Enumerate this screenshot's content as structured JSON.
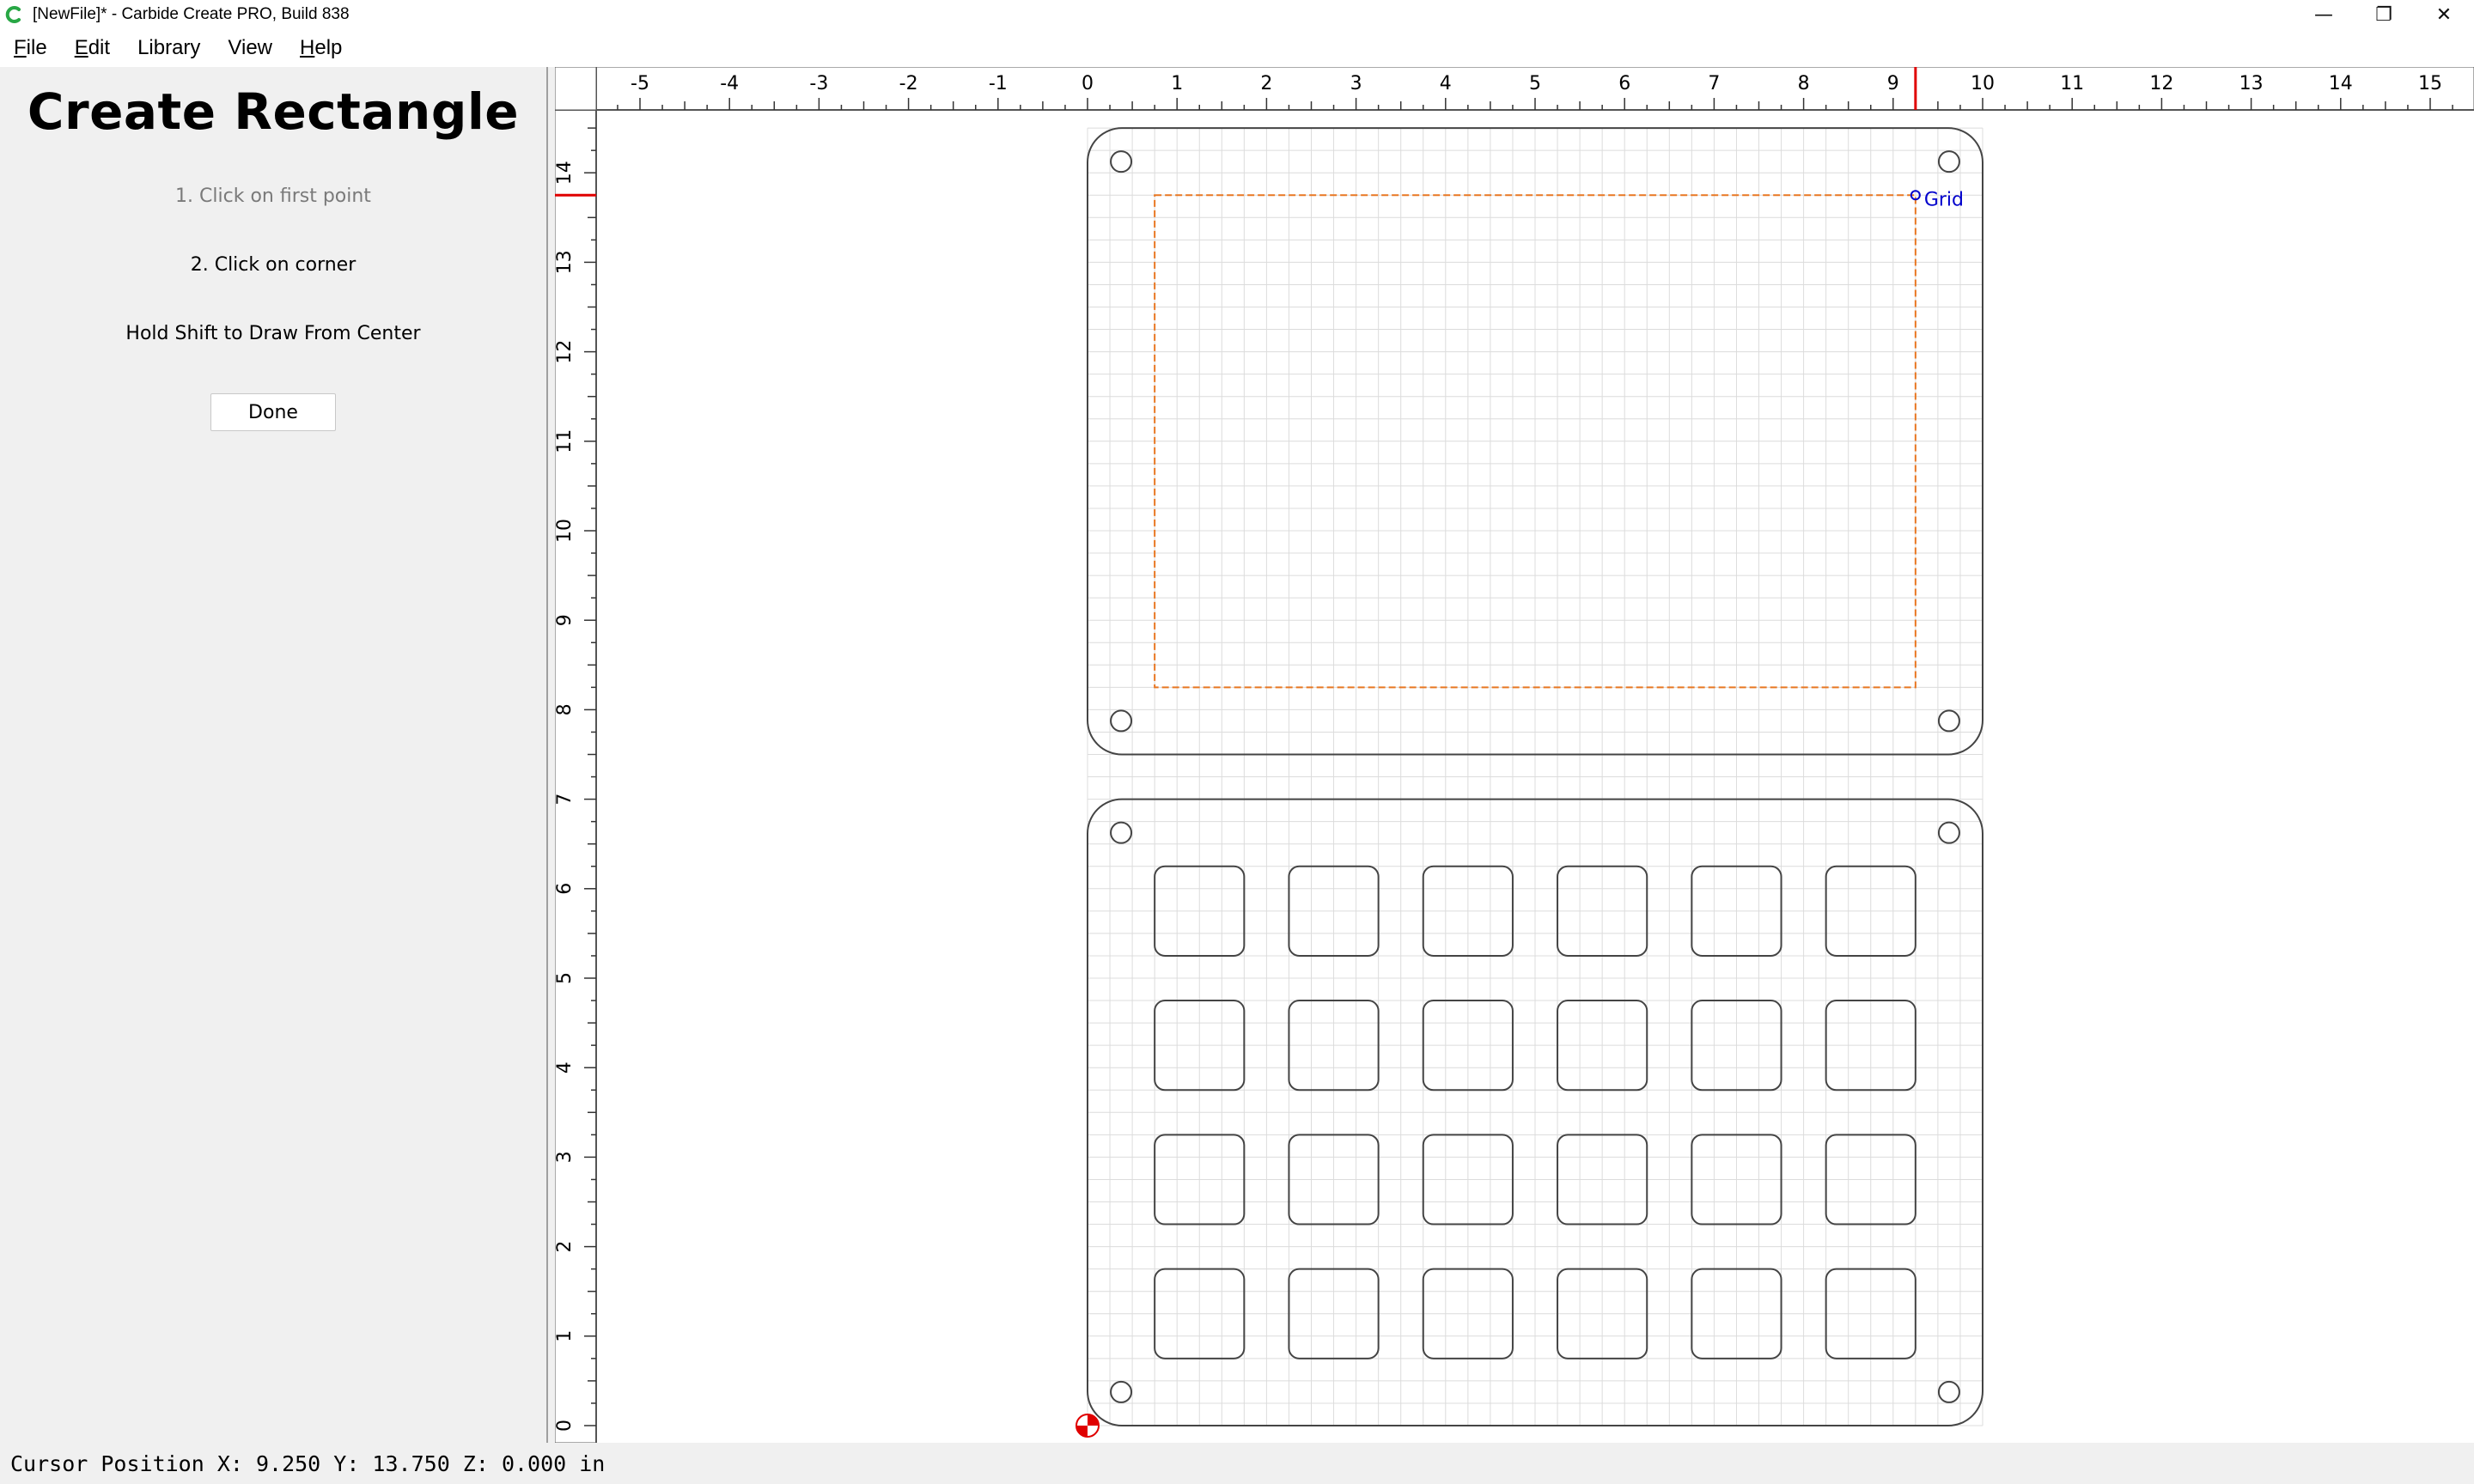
{
  "window": {
    "title": "[NewFile]* - Carbide Create PRO, Build 838",
    "minimize_glyph": "—",
    "restore_glyph": "❐",
    "close_glyph": "✕",
    "app_icon": "carbide-c-icon",
    "accent_color": "#28a745"
  },
  "menu": {
    "items": [
      {
        "mnemonic": "F",
        "rest": "ile"
      },
      {
        "mnemonic": "E",
        "rest": "dit"
      },
      {
        "mnemonic": "",
        "rest": "Library"
      },
      {
        "mnemonic": "",
        "rest": "View"
      },
      {
        "mnemonic": "H",
        "rest": "elp"
      }
    ]
  },
  "panel": {
    "title": "Create Rectangle",
    "step1": "1. Click on first point",
    "step2": "2. Click on corner",
    "shift_hint": "Hold Shift to Draw From Center",
    "done_label": "Done"
  },
  "canvas": {
    "x_ticks": [
      "-5",
      "-4",
      "-3",
      "-2",
      "-1",
      "0",
      "1",
      "2",
      "3",
      "4",
      "5",
      "6",
      "7",
      "8",
      "9",
      "10",
      "11",
      "12",
      "13",
      "14",
      "15"
    ],
    "y_ticks": [
      "0",
      "1",
      "2",
      "3",
      "4",
      "5",
      "6",
      "7",
      "8",
      "9",
      "10",
      "11",
      "12",
      "13",
      "14"
    ],
    "snap_label": "Grid",
    "cursor_x": 9.25,
    "cursor_y": 13.75,
    "plate_width": 10,
    "upper_plate": {
      "y0": 7.5,
      "y1": 14.5
    },
    "lower_plate": {
      "y0": 0,
      "y1": 7.0
    },
    "preview_rect": {
      "x0": 0.75,
      "y0": 8.25,
      "x1": 9.25,
      "y1": 13.75
    },
    "key_grid": {
      "cols": 6,
      "rows": 4,
      "x_start": 0.75,
      "y_start": 0.75,
      "pitch": 1.5,
      "size": 1.0
    },
    "colors": {
      "preview": "#e87722",
      "cursor": "#e00000",
      "snap_label": "#0000cc",
      "grid": "#dcdcdc"
    }
  },
  "status": {
    "cursor_position": "Cursor Position X: 9.250 Y: 13.750 Z: 0.000 in"
  }
}
